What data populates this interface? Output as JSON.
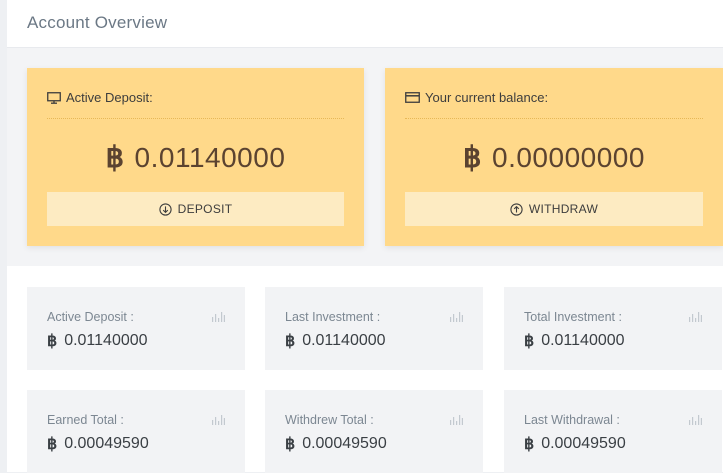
{
  "header": {
    "title": "Account Overview"
  },
  "cards": [
    {
      "label": "Active Deposit:",
      "icon": "monitor-icon",
      "amount": "0.01140000",
      "button_label": "DEPOSIT",
      "button_icon": "arrow-down-circle-icon"
    },
    {
      "label": "Your current balance:",
      "icon": "credit-card-icon",
      "amount": "0.00000000",
      "button_label": "WITHDRAW",
      "button_icon": "arrow-up-circle-icon"
    }
  ],
  "stats": [
    {
      "label": "Active Deposit :",
      "value": "0.01140000"
    },
    {
      "label": "Last Investment :",
      "value": "0.01140000"
    },
    {
      "label": "Total Investment :",
      "value": "0.01140000"
    },
    {
      "label": "Earned Total :",
      "value": "0.00049590"
    },
    {
      "label": "Withdrew Total :",
      "value": "0.00049590"
    },
    {
      "label": "Last Withdrawal :",
      "value": "0.00049590"
    }
  ],
  "currency_symbol": "฿",
  "colors": {
    "card_bg": "#ffd98a",
    "button_bg": "#fdebc2",
    "amount_text": "#5b4330",
    "stat_bg": "#f2f3f5"
  }
}
